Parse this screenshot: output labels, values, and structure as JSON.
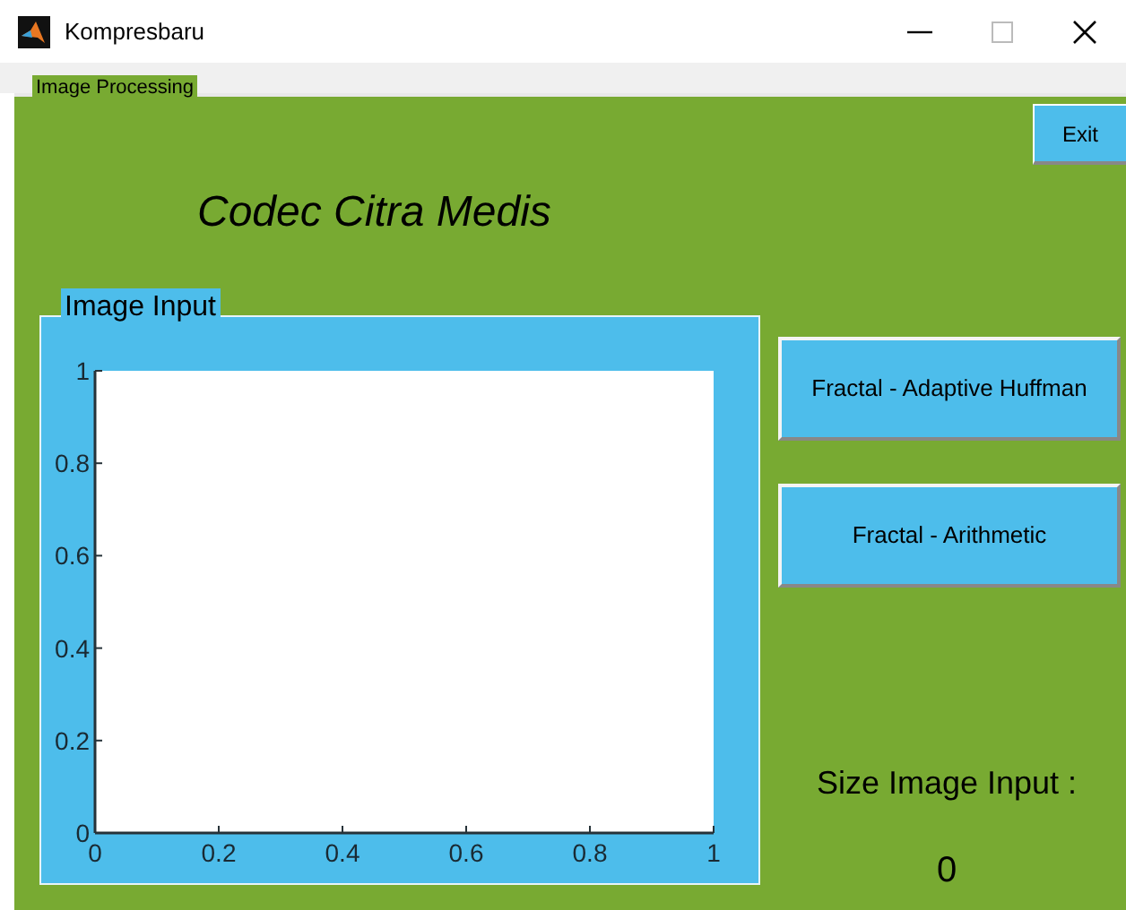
{
  "window": {
    "title": "Kompresbaru"
  },
  "panel": {
    "title": "Image Processing"
  },
  "exit_button": "Exit",
  "heading": "Codec Citra Medis",
  "image_panel": {
    "title": "Image Input",
    "chart_data": {
      "type": "line",
      "xlim": [
        0,
        1
      ],
      "ylim": [
        0,
        1
      ],
      "xticks": [
        {
          "value": 0,
          "label": "0"
        },
        {
          "value": 0.2,
          "label": "0.2"
        },
        {
          "value": 0.4,
          "label": "0.4"
        },
        {
          "value": 0.6,
          "label": "0.6"
        },
        {
          "value": 0.8,
          "label": "0.8"
        },
        {
          "value": 1,
          "label": "1"
        }
      ],
      "yticks": [
        {
          "value": 0,
          "label": "0"
        },
        {
          "value": 0.2,
          "label": "0.2"
        },
        {
          "value": 0.4,
          "label": "0.4"
        },
        {
          "value": 0.6,
          "label": "0.6"
        },
        {
          "value": 0.8,
          "label": "0.8"
        },
        {
          "value": 1,
          "label": "1"
        }
      ]
    }
  },
  "buttons": [
    "Fractal - Adaptive Huffman",
    "Fractal - Arithmetic"
  ],
  "size_label": "Size Image Input :",
  "size_value": "0"
}
